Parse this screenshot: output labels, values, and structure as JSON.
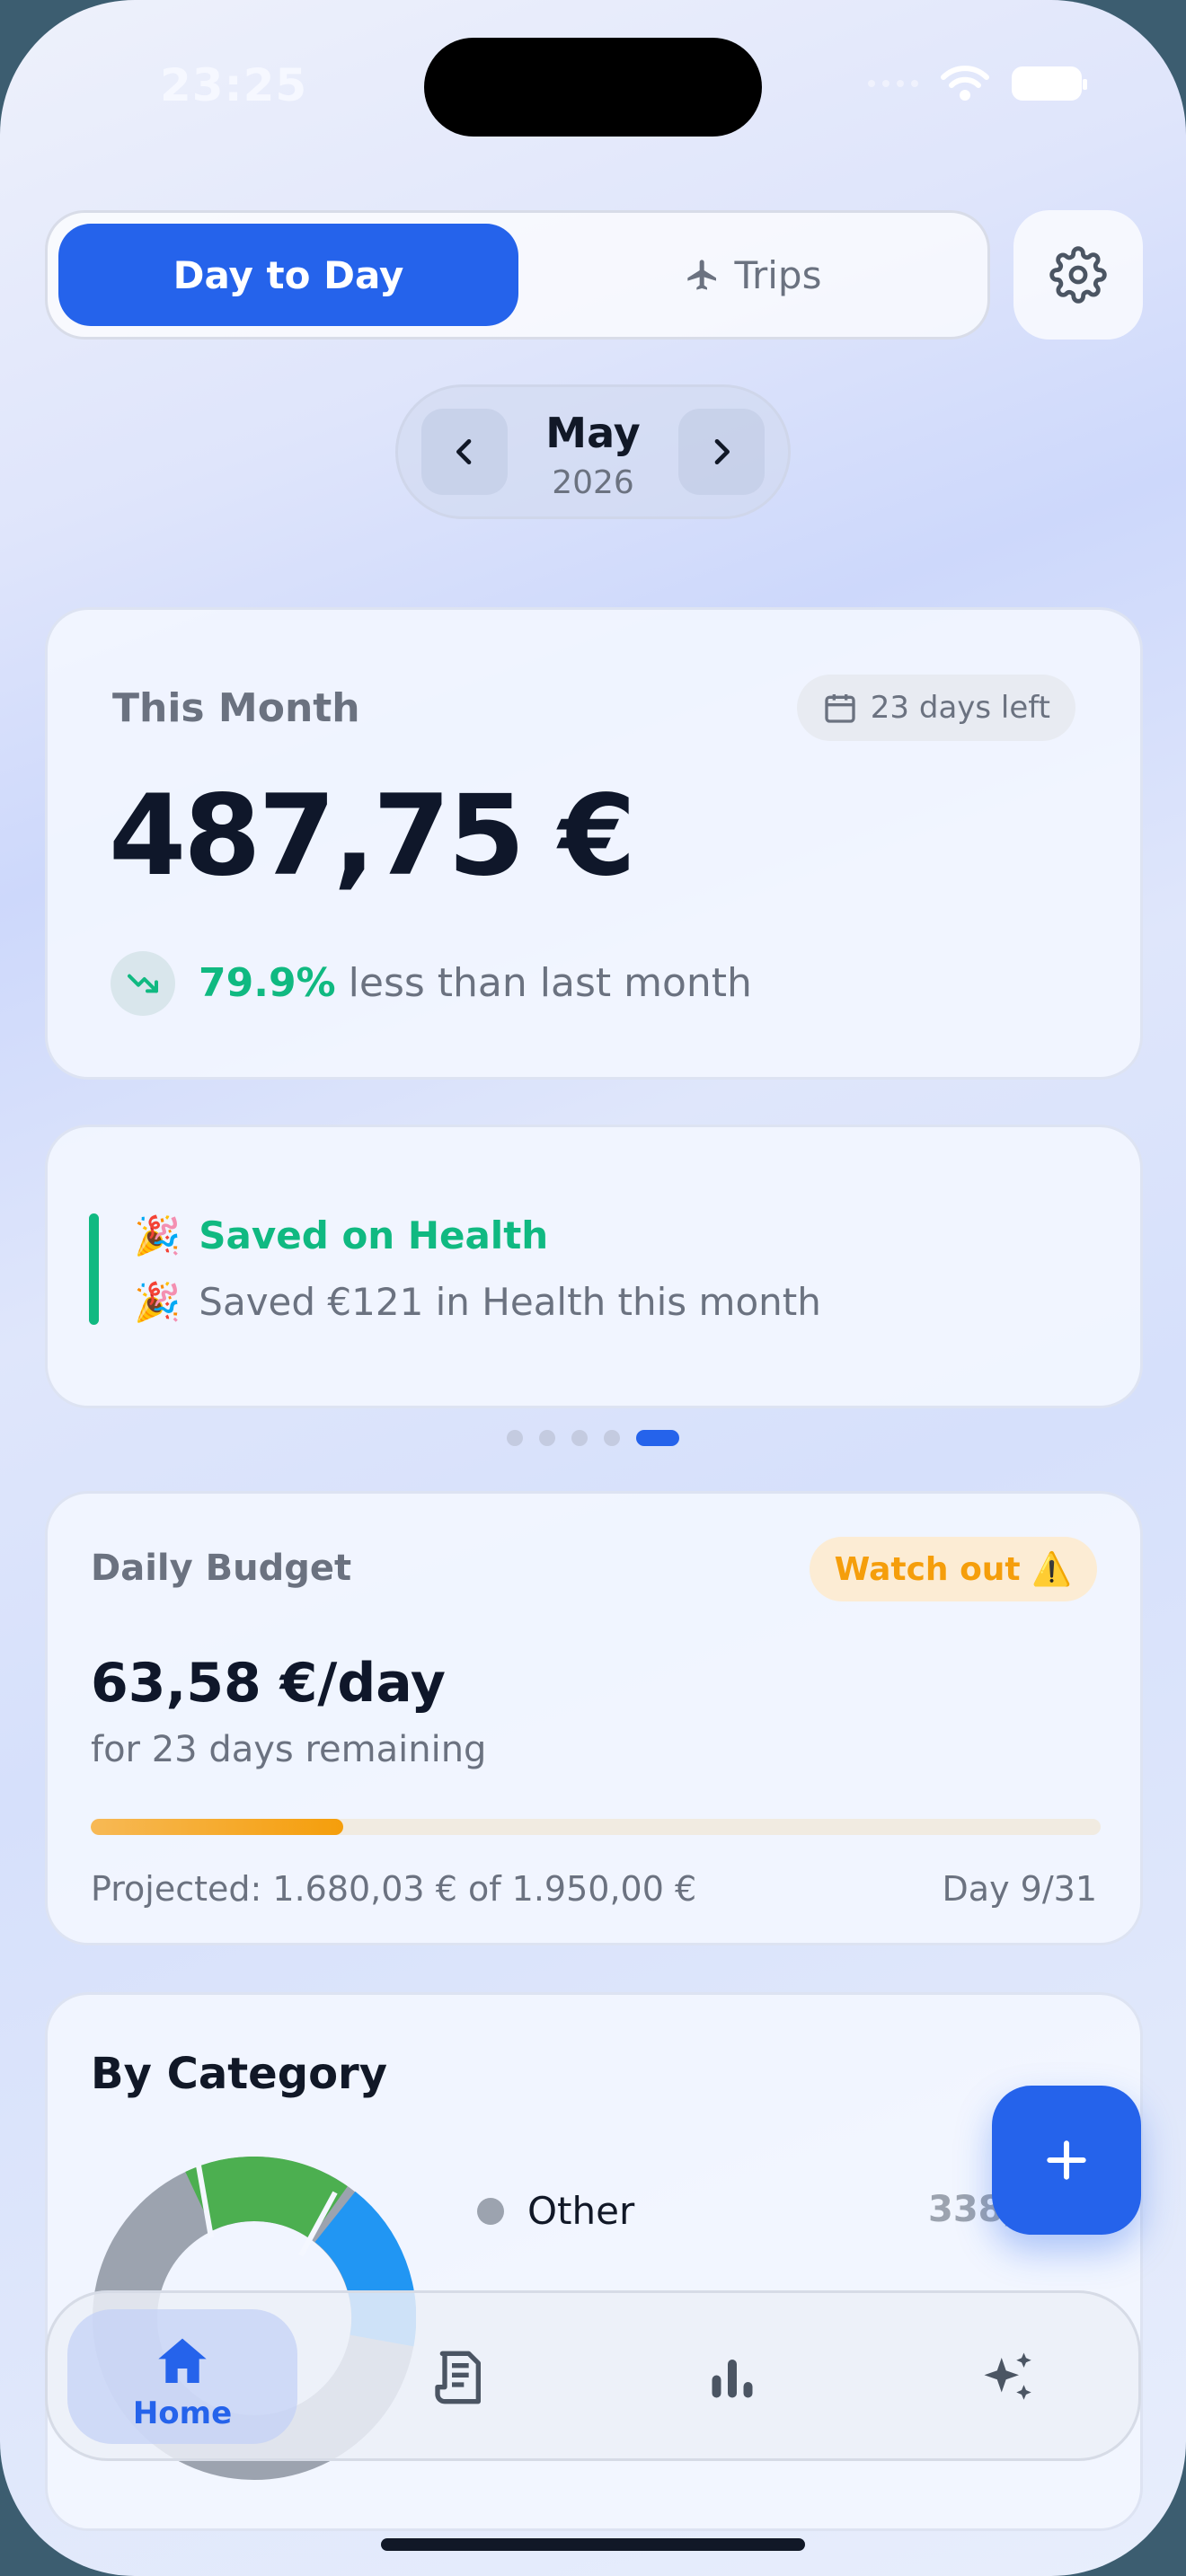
{
  "status": {
    "time": "23:25"
  },
  "mode_switch": {
    "day_to_day": "Day to Day",
    "trips": "Trips"
  },
  "month_nav": {
    "month": "May",
    "year": "2026"
  },
  "this_month": {
    "label": "This Month",
    "days_left": "23 days left",
    "amount": "487,75 €",
    "trend_percent": "79.9%",
    "trend_text": "less than last month"
  },
  "insight": {
    "emoji": "🎉",
    "title": "Saved on Health",
    "subtitle": "Saved €121 in Health this month",
    "pager_count": 5,
    "pager_active": 5
  },
  "daily_budget": {
    "label": "Daily Budget",
    "status": "Watch out ⚠️",
    "amount": "63,58 €/day",
    "sub": "for 23 days remaining",
    "progress": 0.25,
    "projected": "Projected: 1.680,03 € of 1.950,00 €",
    "day": "Day 9/31"
  },
  "by_category": {
    "title": "By Category",
    "items": [
      {
        "name": "Other",
        "value": "338,",
        "color": "#9ca3af"
      }
    ]
  },
  "tabbar": {
    "home": "Home"
  },
  "colors": {
    "accent": "#2563eb",
    "positive": "#10b981",
    "warning": "#f59e0b"
  }
}
